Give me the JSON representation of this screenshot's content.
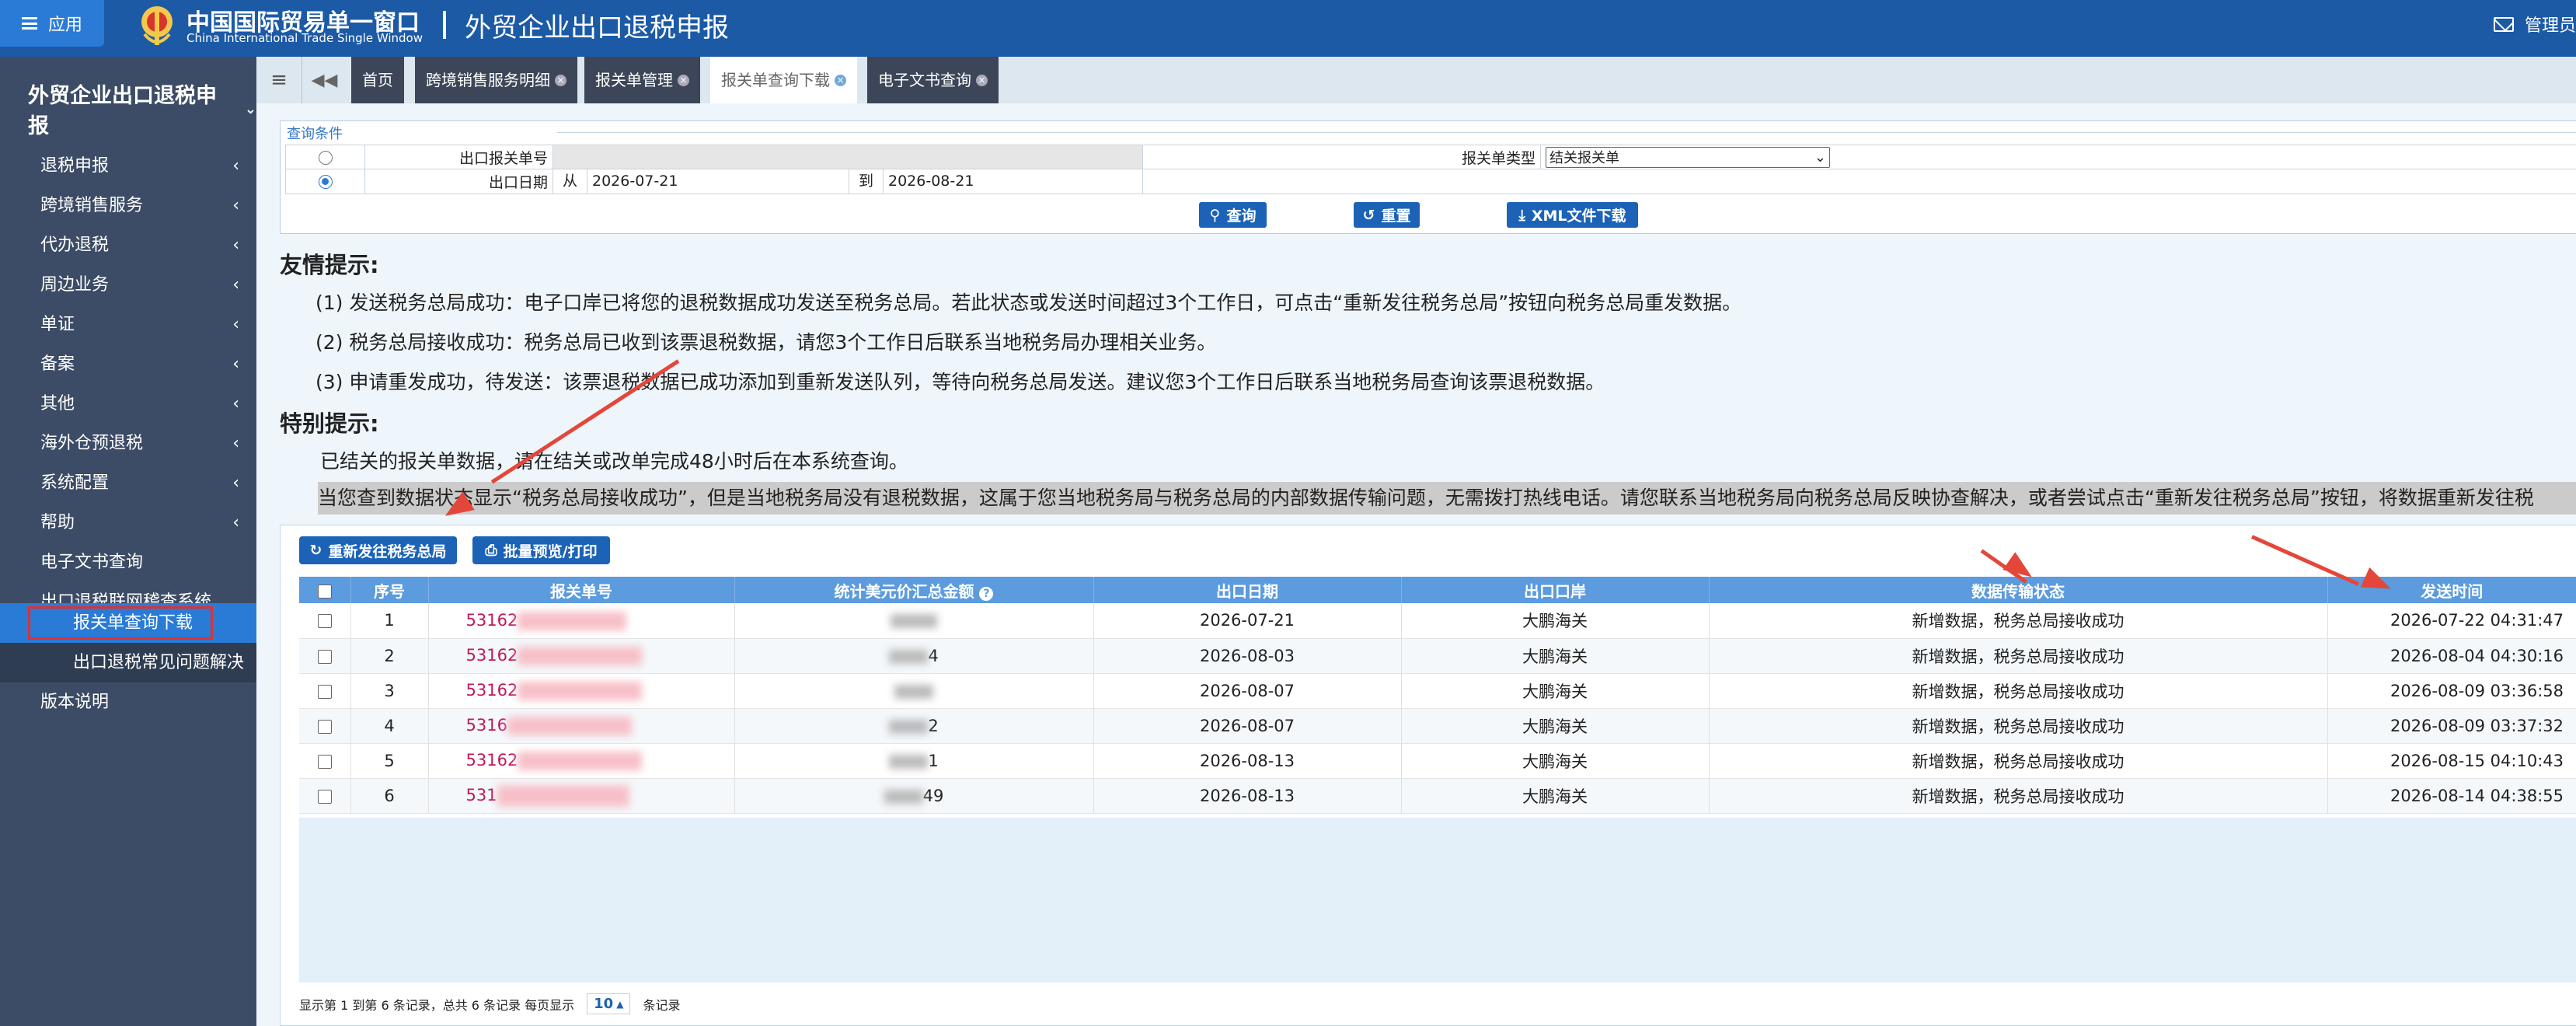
{
  "header": {
    "app_button": "应用",
    "brand_cn": "中国国际贸易单一窗口",
    "brand_en": "China International Trade Single Window",
    "system_title": "外贸企业出口退税申报",
    "user": "管理员"
  },
  "sidebar": {
    "title": "外贸企业出口退税申报",
    "items": [
      {
        "label": "退税申报"
      },
      {
        "label": "跨境销售服务"
      },
      {
        "label": "代办退税"
      },
      {
        "label": "周边业务"
      },
      {
        "label": "单证"
      },
      {
        "label": "备案"
      },
      {
        "label": "其他"
      },
      {
        "label": "海外仓预退税"
      },
      {
        "label": "系统配置"
      },
      {
        "label": "帮助"
      },
      {
        "label": "电子文书查询"
      },
      {
        "label": "出口退税联网稽查系统"
      },
      {
        "label": "报关单查询下载"
      },
      {
        "label": "出口退税常见问题解决"
      },
      {
        "label": "版本说明"
      }
    ]
  },
  "tabs": [
    {
      "label": "首页"
    },
    {
      "label": "跨境销售服务明细"
    },
    {
      "label": "报关单管理"
    },
    {
      "label": "报关单查询下载"
    },
    {
      "label": "电子文书查询"
    }
  ],
  "query": {
    "legend": "查询条件",
    "decl_no_label": "出口报关单号",
    "export_date_label": "出口日期",
    "from_label": "从",
    "to_label": "到",
    "date_from": "2026-07-21",
    "date_to": "2026-08-21",
    "decl_type_label": "报关单类型",
    "decl_type_value": "结关报关单",
    "btn_query": "查询",
    "btn_reset": "重置",
    "btn_xml": "XML文件下载"
  },
  "hints": {
    "friendly_title": "友情提示:",
    "line1": "(1) 发送税务总局成功：电子口岸已将您的退税数据成功发送至税务总局。若此状态或发送时间超过3个工作日，可点击“重新发往税务总局”按钮向税务总局重发数据。",
    "line2": "(2) 税务总局接收成功：税务总局已收到该票退税数据，请您3个工作日后联系当地税务局办理相关业务。",
    "line3": "(3) 申请重发成功，待发送：该票退税数据已成功添加到重新发送队列，等待向税务总局发送。建议您3个工作日后联系当地税务局查询该票退税数据。",
    "special_title": "特别提示:",
    "special1": "已结关的报关单数据，请在结关或改单完成48小时后在本系统查询。",
    "special2": "当您查到数据状态显示“税务总局接收成功”，但是当地税务局没有退税数据，这属于您当地税务局与税务总局的内部数据传输问题，无需拨打热线电话。请您联系当地税务局向税务总局反映协查解决，或者尝试点击“重新发往税务总局”按钮，将数据重新发往税"
  },
  "actions": {
    "resend": "重新发往税务总局",
    "batch_print": "批量预览/打印"
  },
  "table": {
    "columns": [
      "序号",
      "报关单号",
      "统计美元价汇总金额",
      "出口日期",
      "出口口岸",
      "数据传输状态",
      "发送时间"
    ],
    "rows": [
      {
        "no": "1",
        "decl": "53162",
        "amount": "",
        "date": "2026-07-21",
        "port": "大鹏海关",
        "status": "新增数据，税务总局接收成功",
        "sent": "2026-07-22 04:31:47"
      },
      {
        "no": "2",
        "decl": "53162",
        "amount": "4",
        "date": "2026-08-03",
        "port": "大鹏海关",
        "status": "新增数据，税务总局接收成功",
        "sent": "2026-08-04 04:30:16"
      },
      {
        "no": "3",
        "decl": "53162",
        "amount": "",
        "date": "2026-08-07",
        "port": "大鹏海关",
        "status": "新增数据，税务总局接收成功",
        "sent": "2026-08-09 03:36:58"
      },
      {
        "no": "4",
        "decl": "5316",
        "amount": "2",
        "date": "2026-08-07",
        "port": "大鹏海关",
        "status": "新增数据，税务总局接收成功",
        "sent": "2026-08-09 03:37:32"
      },
      {
        "no": "5",
        "decl": "53162",
        "amount": "1",
        "date": "2026-08-13",
        "port": "大鹏海关",
        "status": "新增数据，税务总局接收成功",
        "sent": "2026-08-15 04:10:43"
      },
      {
        "no": "6",
        "decl": "531",
        "amount": "49",
        "date": "2026-08-13",
        "port": "大鹏海关",
        "status": "新增数据，税务总局接收成功",
        "sent": "2026-08-14 04:38:55"
      }
    ]
  },
  "pager": {
    "text1": "显示第 1 到第 6 条记录，总共 6 条记录 每页显示",
    "page_size": "10",
    "text2": "条记录"
  },
  "colors": {
    "topbar": "#1c5aa6",
    "sidebar": "#3c4c66",
    "accent": "#2a7bd6",
    "annotation": "#e4463a"
  }
}
